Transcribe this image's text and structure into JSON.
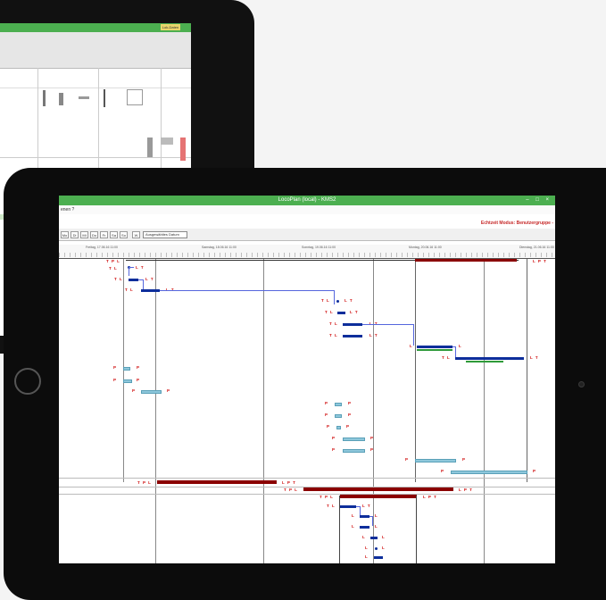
{
  "app": {
    "title": "LocoPlan (local) - KMS2",
    "menu": "enen ?",
    "mode_text": "Echtzeit Modus: Benutzergruppe -",
    "window_controls": "– □ ×"
  },
  "toolbar": {
    "buttons": [
      "Mo",
      "Di",
      "Mi",
      "Do",
      "Fr",
      "Sa",
      "So",
      "W"
    ],
    "date_select": "Ausgewähltes Datum"
  },
  "header": {
    "days": [
      "Freitag, 17.06.16 11:00",
      "Samstag, 18.06.16 11:00",
      "Sonntag, 19.06.16 11:00",
      "Montag, 20.06.16 11:00",
      "Dienstag, 21.06.16 11:00"
    ]
  },
  "labels": {
    "tpl": "T P L",
    "tl": "T L",
    "lt": "L T",
    "lpt": "L P T",
    "p": "P",
    "l": "L"
  },
  "back_screen": {
    "badge": "Lok-Daten"
  },
  "colors": {
    "accent": "#4caf50",
    "navy": "#0d2e9b",
    "maroon": "#8b0000",
    "light_blue": "#8ec7db",
    "green": "#2e9a3a",
    "red_label": "#d01010"
  }
}
